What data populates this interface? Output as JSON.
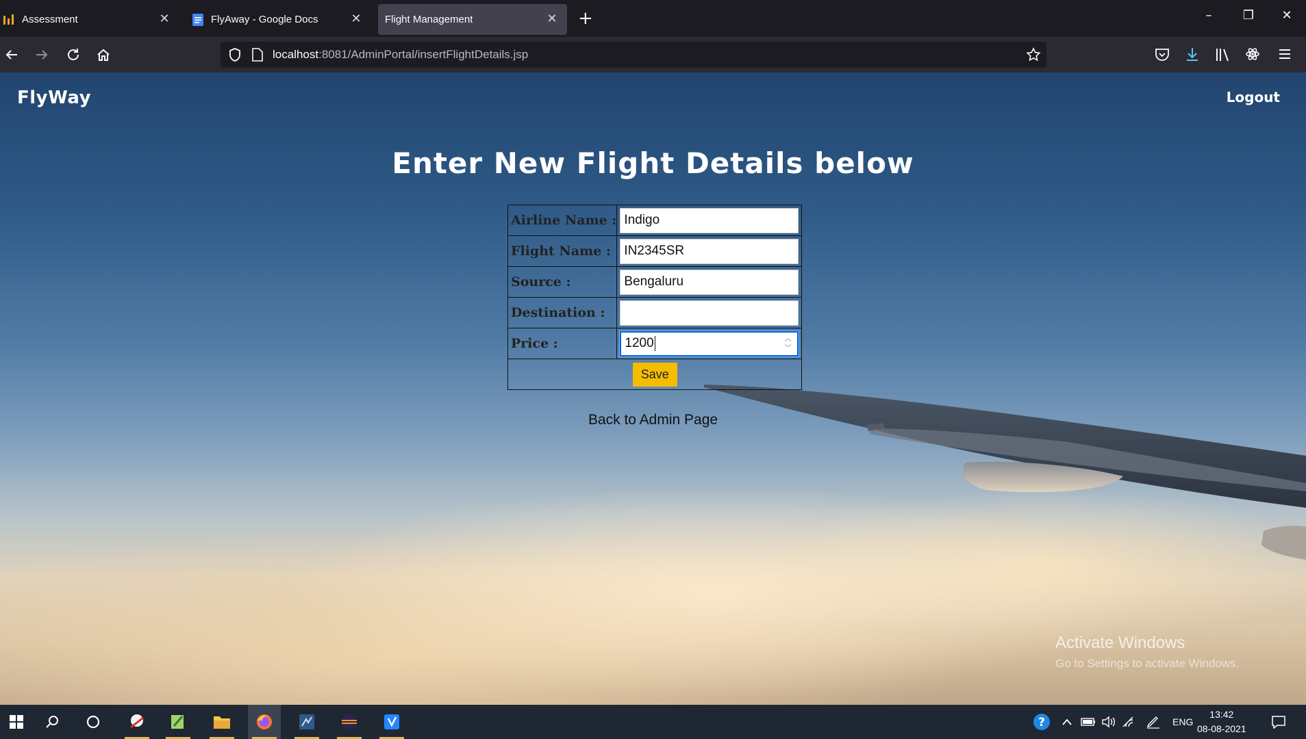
{
  "browser": {
    "tabs": [
      {
        "title": "Assessment",
        "active": false
      },
      {
        "title": "FlyAway - Google Docs",
        "active": false
      },
      {
        "title": "Flight Management",
        "active": true
      }
    ],
    "url_host": "localhost",
    "url_path": ":8081/AdminPortal/insertFlightDetails.jsp"
  },
  "page": {
    "brand": "FlyWay",
    "logout_label": "Logout",
    "heading": "Enter New Flight Details below",
    "form": {
      "fields": [
        {
          "label": "Airline Name :",
          "value": "Indigo"
        },
        {
          "label": "Flight Name :",
          "value": "IN2345SR"
        },
        {
          "label": "Source :",
          "value": "Bengaluru"
        },
        {
          "label": "Destination :",
          "value": ""
        },
        {
          "label": "Price :",
          "value": "1200"
        }
      ],
      "save_label": "Save"
    },
    "back_link": "Back to Admin Page"
  },
  "watermark": {
    "line1": "Activate Windows",
    "line2": "Go to Settings to activate Windows."
  },
  "taskbar": {
    "language": "ENG",
    "time": "13:42",
    "date": "08-08-2021"
  },
  "colors": {
    "save_button": "#f5bd00",
    "focus_ring": "#0060df",
    "tab_active": "#42414d"
  }
}
